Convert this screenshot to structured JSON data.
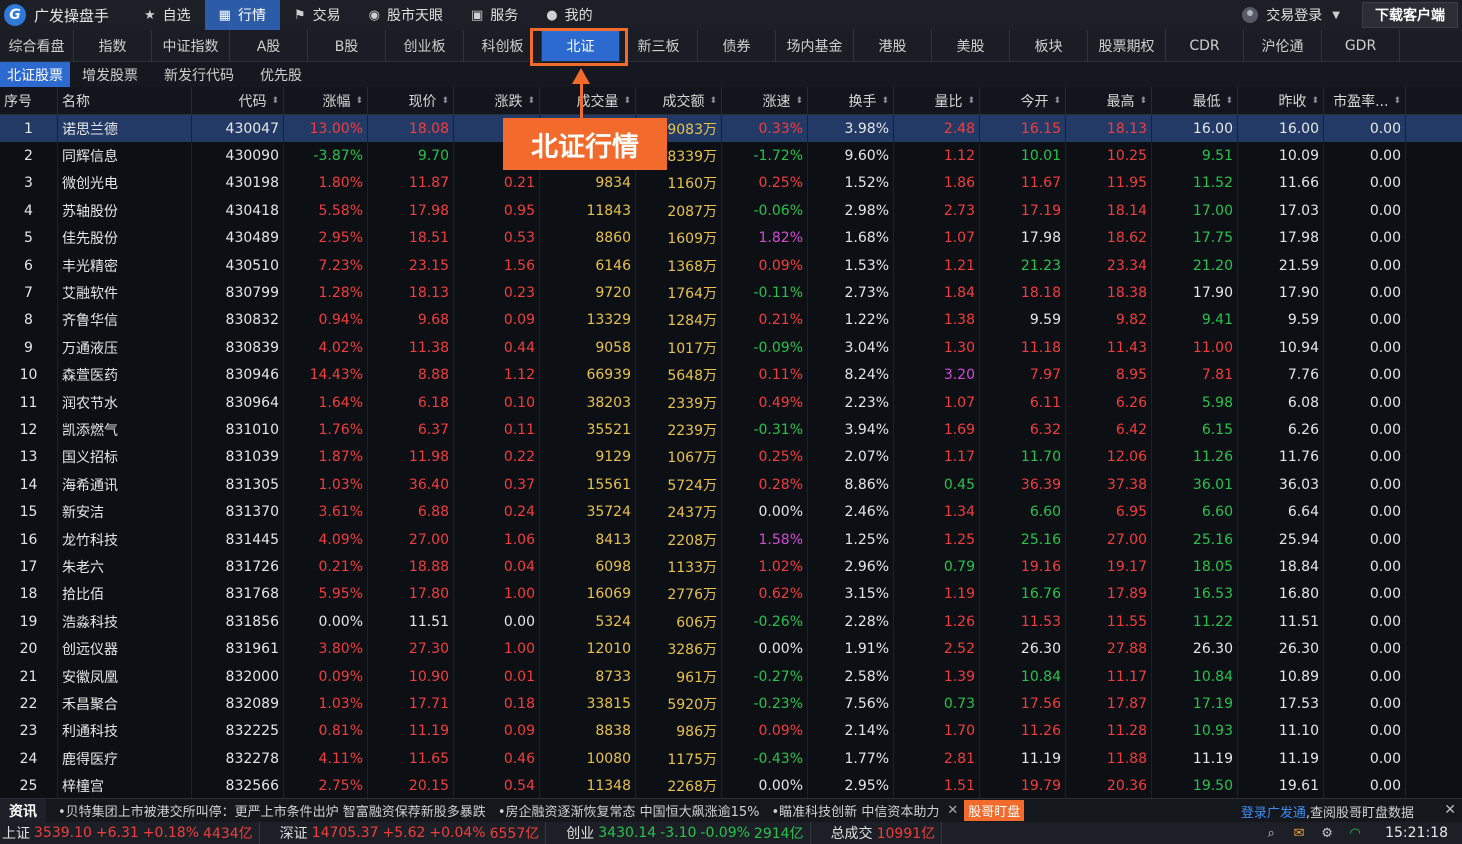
{
  "topbar": {
    "brand": "广发操盘手",
    "brand_icon": "gf-logo-icon",
    "nav": [
      {
        "label": "自选",
        "icon": "star-icon",
        "glyph": "★",
        "active": false
      },
      {
        "label": "行情",
        "icon": "chart-icon",
        "glyph": "▦",
        "active": true
      },
      {
        "label": "交易",
        "icon": "trade-icon",
        "glyph": "⚑",
        "active": false
      },
      {
        "label": "股市天眼",
        "icon": "eye-icon",
        "glyph": "◉",
        "active": false
      },
      {
        "label": "服务",
        "icon": "briefcase-icon",
        "glyph": "▣",
        "active": false
      },
      {
        "label": "我的",
        "icon": "user-icon",
        "glyph": "●",
        "active": false
      }
    ],
    "login_label": "交易登录",
    "download_label": "下载客户端"
  },
  "market_tabs": [
    {
      "label": "综合看盘",
      "w": 0
    },
    {
      "label": "指数"
    },
    {
      "label": "中证指数"
    },
    {
      "label": "A股"
    },
    {
      "label": "B股"
    },
    {
      "label": "创业板"
    },
    {
      "label": "科创板"
    },
    {
      "label": "北证",
      "active": true
    },
    {
      "label": "新三板"
    },
    {
      "label": "债券"
    },
    {
      "label": "场内基金"
    },
    {
      "label": "港股"
    },
    {
      "label": "美股"
    },
    {
      "label": "板块"
    },
    {
      "label": "股票期权"
    },
    {
      "label": "CDR"
    },
    {
      "label": "沪伦通"
    },
    {
      "label": "GDR"
    }
  ],
  "sub_tabs": [
    {
      "label": "北证股票",
      "active": true
    },
    {
      "label": "增发股票"
    },
    {
      "label": "新发行代码"
    },
    {
      "label": "优先股"
    }
  ],
  "table": {
    "columns": [
      "序号",
      "名称",
      "代码",
      "涨幅",
      "现价",
      "涨跌",
      "成交量",
      "成交额",
      "涨速",
      "换手",
      "量比",
      "今开",
      "最高",
      "最低",
      "昨收",
      "市盈率..."
    ],
    "rows": [
      [
        "1",
        "诺思兰德",
        "430047",
        "13.00%",
        "18.08",
        "2.08",
        "",
        "9083万",
        "0.33%",
        "3.98%",
        "2.48",
        "16.15",
        "18.13",
        "16.00",
        "16.00",
        "0.00"
      ],
      [
        "2",
        "同辉信息",
        "430090",
        "-3.87%",
        "9.70",
        "",
        "",
        "8339万",
        "-1.72%",
        "9.60%",
        "1.12",
        "10.01",
        "10.25",
        "9.51",
        "10.09",
        "0.00"
      ],
      [
        "3",
        "微创光电",
        "430198",
        "1.80%",
        "11.87",
        "0.21",
        "9834",
        "1160万",
        "0.25%",
        "1.52%",
        "1.86",
        "11.67",
        "11.95",
        "11.52",
        "11.66",
        "0.00"
      ],
      [
        "4",
        "苏轴股份",
        "430418",
        "5.58%",
        "17.98",
        "0.95",
        "11843",
        "2087万",
        "-0.06%",
        "2.98%",
        "2.73",
        "17.19",
        "18.14",
        "17.00",
        "17.03",
        "0.00"
      ],
      [
        "5",
        "佳先股份",
        "430489",
        "2.95%",
        "18.51",
        "0.53",
        "8860",
        "1609万",
        "1.82%",
        "1.68%",
        "1.07",
        "17.98",
        "18.62",
        "17.75",
        "17.98",
        "0.00"
      ],
      [
        "6",
        "丰光精密",
        "430510",
        "7.23%",
        "23.15",
        "1.56",
        "6146",
        "1368万",
        "0.09%",
        "1.53%",
        "1.21",
        "21.23",
        "23.34",
        "21.20",
        "21.59",
        "0.00"
      ],
      [
        "7",
        "艾融软件",
        "830799",
        "1.28%",
        "18.13",
        "0.23",
        "9720",
        "1764万",
        "-0.11%",
        "2.73%",
        "1.84",
        "18.18",
        "18.38",
        "17.90",
        "17.90",
        "0.00"
      ],
      [
        "8",
        "齐鲁华信",
        "830832",
        "0.94%",
        "9.68",
        "0.09",
        "13329",
        "1284万",
        "0.21%",
        "1.22%",
        "1.38",
        "9.59",
        "9.82",
        "9.41",
        "9.59",
        "0.00"
      ],
      [
        "9",
        "万通液压",
        "830839",
        "4.02%",
        "11.38",
        "0.44",
        "9058",
        "1017万",
        "-0.09%",
        "3.04%",
        "1.30",
        "11.18",
        "11.43",
        "11.00",
        "10.94",
        "0.00"
      ],
      [
        "10",
        "森萱医药",
        "830946",
        "14.43%",
        "8.88",
        "1.12",
        "66939",
        "5648万",
        "0.11%",
        "8.24%",
        "3.20",
        "7.97",
        "8.95",
        "7.81",
        "7.76",
        "0.00"
      ],
      [
        "11",
        "润农节水",
        "830964",
        "1.64%",
        "6.18",
        "0.10",
        "38203",
        "2339万",
        "0.49%",
        "2.23%",
        "1.07",
        "6.11",
        "6.26",
        "5.98",
        "6.08",
        "0.00"
      ],
      [
        "12",
        "凯添燃气",
        "831010",
        "1.76%",
        "6.37",
        "0.11",
        "35521",
        "2239万",
        "-0.31%",
        "3.94%",
        "1.69",
        "6.32",
        "6.42",
        "6.15",
        "6.26",
        "0.00"
      ],
      [
        "13",
        "国义招标",
        "831039",
        "1.87%",
        "11.98",
        "0.22",
        "9129",
        "1067万",
        "0.25%",
        "2.07%",
        "1.17",
        "11.70",
        "12.06",
        "11.26",
        "11.76",
        "0.00"
      ],
      [
        "14",
        "海希通讯",
        "831305",
        "1.03%",
        "36.40",
        "0.37",
        "15561",
        "5724万",
        "0.28%",
        "8.86%",
        "0.45",
        "36.39",
        "37.38",
        "36.01",
        "36.03",
        "0.00"
      ],
      [
        "15",
        "新安洁",
        "831370",
        "3.61%",
        "6.88",
        "0.24",
        "35724",
        "2437万",
        "0.00%",
        "2.46%",
        "1.34",
        "6.60",
        "6.95",
        "6.60",
        "6.64",
        "0.00"
      ],
      [
        "16",
        "龙竹科技",
        "831445",
        "4.09%",
        "27.00",
        "1.06",
        "8413",
        "2208万",
        "1.58%",
        "1.25%",
        "1.25",
        "25.16",
        "27.00",
        "25.16",
        "25.94",
        "0.00"
      ],
      [
        "17",
        "朱老六",
        "831726",
        "0.21%",
        "18.88",
        "0.04",
        "6098",
        "1133万",
        "1.02%",
        "2.96%",
        "0.79",
        "19.16",
        "19.17",
        "18.05",
        "18.84",
        "0.00"
      ],
      [
        "18",
        "拾比佰",
        "831768",
        "5.95%",
        "17.80",
        "1.00",
        "16069",
        "2776万",
        "0.62%",
        "3.15%",
        "1.19",
        "16.76",
        "17.89",
        "16.53",
        "16.80",
        "0.00"
      ],
      [
        "19",
        "浩淼科技",
        "831856",
        "0.00%",
        "11.51",
        "0.00",
        "5324",
        "606万",
        "-0.26%",
        "2.28%",
        "1.26",
        "11.53",
        "11.55",
        "11.22",
        "11.51",
        "0.00"
      ],
      [
        "20",
        "创远仪器",
        "831961",
        "3.80%",
        "27.30",
        "1.00",
        "12010",
        "3286万",
        "0.00%",
        "1.91%",
        "2.52",
        "26.30",
        "27.88",
        "26.30",
        "26.30",
        "0.00"
      ],
      [
        "21",
        "安徽凤凰",
        "832000",
        "0.09%",
        "10.90",
        "0.01",
        "8733",
        "961万",
        "-0.27%",
        "2.58%",
        "1.39",
        "10.84",
        "11.17",
        "10.84",
        "10.89",
        "0.00"
      ],
      [
        "22",
        "禾昌聚合",
        "832089",
        "1.03%",
        "17.71",
        "0.18",
        "33815",
        "5920万",
        "-0.23%",
        "7.56%",
        "0.73",
        "17.56",
        "17.87",
        "17.19",
        "17.53",
        "0.00"
      ],
      [
        "23",
        "利通科技",
        "832225",
        "0.81%",
        "11.19",
        "0.09",
        "8838",
        "986万",
        "0.09%",
        "2.14%",
        "1.70",
        "11.26",
        "11.28",
        "10.93",
        "11.10",
        "0.00"
      ],
      [
        "24",
        "鹿得医疗",
        "832278",
        "4.11%",
        "11.65",
        "0.46",
        "10080",
        "1175万",
        "-0.43%",
        "1.77%",
        "2.81",
        "11.19",
        "11.88",
        "11.19",
        "11.19",
        "0.00"
      ],
      [
        "25",
        "梓橦宫",
        "832566",
        "2.75%",
        "20.15",
        "0.54",
        "11348",
        "2268万",
        "0.00%",
        "2.95%",
        "1.51",
        "19.79",
        "20.36",
        "19.50",
        "19.61",
        "0.00"
      ]
    ]
  },
  "callout": {
    "label": "北证行情"
  },
  "news": {
    "label": "资讯",
    "items": [
      "•贝特集团上市被港交所叫停：更严上市条件出炉 智富融资保荐新股多暴跌",
      "•房企融资逐渐恢复常态 中国恒大飙涨逾15%",
      "•瞄准科技创新 中信资本助力"
    ],
    "badge": "股哥盯盘",
    "login_link": "登录广发通",
    "login_rest": ",查阅股哥盯盘数据"
  },
  "status": {
    "indices": [
      {
        "name": "上证",
        "value": "3539.10",
        "change": "+6.31",
        "pct": "+0.18%",
        "amount": "4434亿"
      },
      {
        "name": "深证",
        "value": "14705.37",
        "change": "+5.62",
        "pct": "+0.04%",
        "amount": "6557亿"
      },
      {
        "name": "创业",
        "value": "3430.14",
        "change": "-3.10",
        "pct": "-0.09%",
        "amount": "2914亿"
      }
    ],
    "total_label": "总成交",
    "total_value": "10991亿",
    "time": "15:21:18"
  },
  "colors": {
    "up": "#f23d3d",
    "down": "#27c24c",
    "accent": "#2c6ad0",
    "callout": "#f26b2d"
  }
}
